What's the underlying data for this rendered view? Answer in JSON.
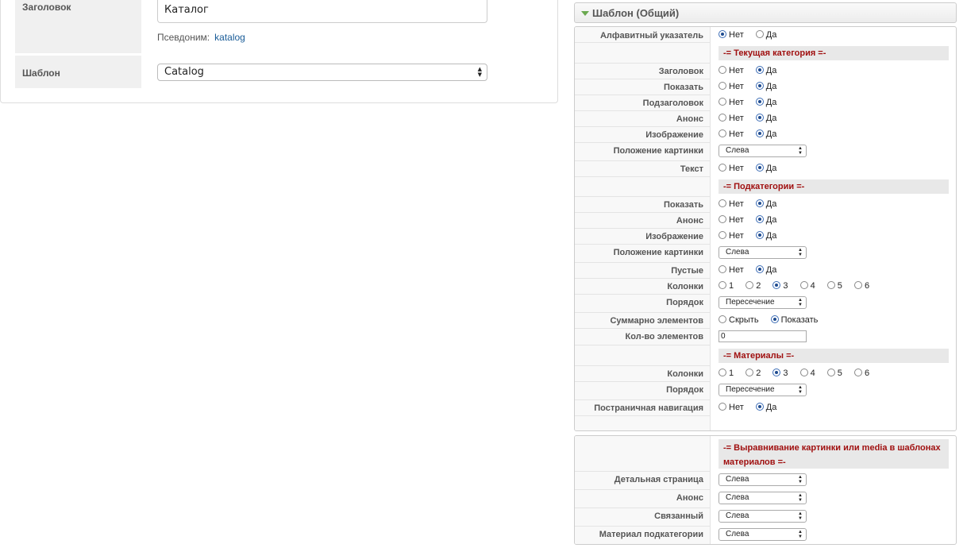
{
  "left": {
    "title_label": "Заголовок",
    "title_value": "Каталог",
    "alias_label": "Псевдоним:",
    "alias_value": "katalog",
    "template_label": "Шаблон",
    "template_value": "Catalog"
  },
  "accordion": {
    "title": "Шаблон (Общий)"
  },
  "settings": {
    "alphabet": {
      "label": "Алфавитный указатель",
      "no": "Нет",
      "yes": "Да"
    },
    "section_current": "-= Текущая категория =-",
    "cur_title": {
      "label": "Заголовок",
      "no": "Нет",
      "yes": "Да"
    },
    "cur_show": {
      "label": "Показать",
      "no": "Нет",
      "yes": "Да"
    },
    "cur_subtitle": {
      "label": "Подзаголовок",
      "no": "Нет",
      "yes": "Да"
    },
    "cur_intro": {
      "label": "Анонс",
      "no": "Нет",
      "yes": "Да"
    },
    "cur_image": {
      "label": "Изображение",
      "no": "Нет",
      "yes": "Да"
    },
    "cur_image_pos": {
      "label": "Положение картинки",
      "value": "Слева"
    },
    "cur_text": {
      "label": "Текст",
      "no": "Нет",
      "yes": "Да"
    },
    "section_sub": "-= Подкатегории =-",
    "sub_show": {
      "label": "Показать",
      "no": "Нет",
      "yes": "Да"
    },
    "sub_intro": {
      "label": "Анонс",
      "no": "Нет",
      "yes": "Да"
    },
    "sub_image": {
      "label": "Изображение",
      "no": "Нет",
      "yes": "Да"
    },
    "sub_image_pos": {
      "label": "Положение картинки",
      "value": "Слева"
    },
    "sub_empty": {
      "label": "Пустые",
      "no": "Нет",
      "yes": "Да"
    },
    "sub_columns": {
      "label": "Колонки",
      "options": [
        "1",
        "2",
        "3",
        "4",
        "5",
        "6"
      ],
      "selected": "3"
    },
    "sub_order": {
      "label": "Порядок",
      "value": "Пересечение"
    },
    "sub_total": {
      "label": "Суммарно элементов",
      "hide": "Скрыть",
      "show": "Показать"
    },
    "sub_count": {
      "label": "Кол-во элементов",
      "value": "0"
    },
    "section_materials": "-= Материалы =-",
    "mat_columns": {
      "label": "Колонки",
      "options": [
        "1",
        "2",
        "3",
        "4",
        "5",
        "6"
      ],
      "selected": "3"
    },
    "mat_order": {
      "label": "Порядок",
      "value": "Пересечение"
    },
    "mat_pagination": {
      "label": "Постраничная навигация",
      "no": "Нет",
      "yes": "Да"
    }
  },
  "alignment": {
    "section_line1": "-= Выравнивание картинки или media в шаблонах",
    "section_line2": "материалов =-",
    "detail": {
      "label": "Детальная страница",
      "value": "Слева"
    },
    "intro": {
      "label": "Анонс",
      "value": "Слева"
    },
    "related": {
      "label": "Связанный",
      "value": "Слева"
    },
    "subcat_material": {
      "label": "Материал подкатегории",
      "value": "Слева"
    }
  },
  "colors": {
    "section_text": "#a01010",
    "accent": "#6aa84f",
    "link": "#1a5c98"
  }
}
